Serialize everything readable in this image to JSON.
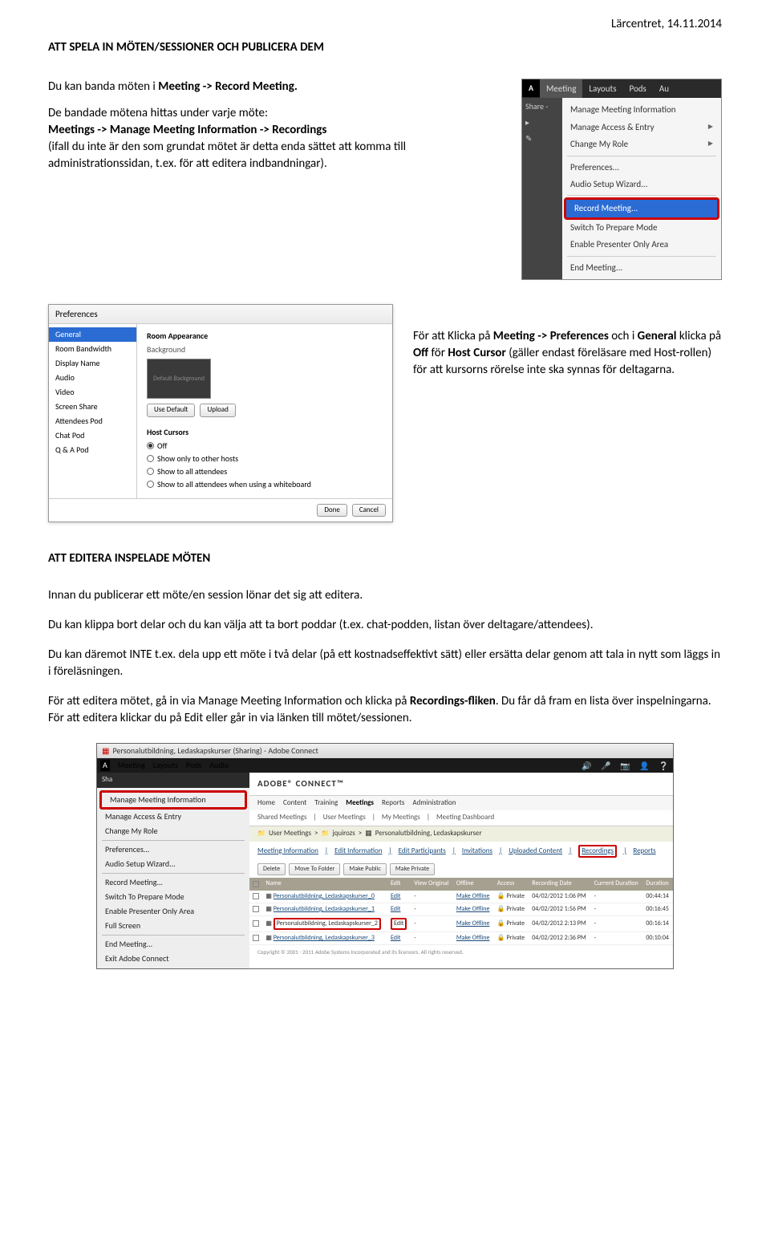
{
  "header_date": "Lärcentret, 14.11.2014",
  "doc_title": "ATT SPELA IN MÖTEN/SESSIONER OCH PUBLICERA DEM",
  "p1_a": "Du kan banda möten i ",
  "p1_b": "Meeting -> Record Meeting.",
  "p2_a": "De bandade mötena hittas under varje möte:",
  "p2_b": "Meetings -> Manage Meeting Information -> Recordings",
  "p2_c": "(ifall du inte är den som grundat mötet är detta enda sättet att komma till administrationssidan, t.ex. för att editera indbandningar).",
  "ss1": {
    "tabs": [
      "Meeting",
      "Layouts",
      "Pods",
      "Au"
    ],
    "share": "Share -",
    "items": [
      "Manage Meeting Information",
      "Manage Access & Entry",
      "Change My Role"
    ],
    "items2": [
      "Preferences...",
      "Audio Setup Wizard..."
    ],
    "record": "Record Meeting...",
    "items3": [
      "Switch To Prepare Mode",
      "Enable Presenter Only Area"
    ],
    "end": "End Meeting..."
  },
  "ss2": {
    "title": "Preferences",
    "side": [
      "General",
      "Room Bandwidth",
      "Display Name",
      "Audio",
      "Video",
      "Screen Share",
      "Attendees Pod",
      "Chat Pod",
      "Q & A Pod"
    ],
    "h1": "Room Appearance",
    "sub1": "Background",
    "thumb": "Default Background",
    "btn_use": "Use Default",
    "btn_up": "Upload",
    "h2": "Host Cursors",
    "r1": "Off",
    "r2": "Show only to other hosts",
    "r3": "Show to all attendees",
    "r4": "Show to all attendees when using a whiteboard",
    "done": "Done",
    "cancel": "Cancel"
  },
  "p3_a": "För att Klicka på ",
  "p3_b": "Meeting -> Preferences",
  "p3_c": " och i ",
  "p3_d": "General",
  "p3_e": " klicka på ",
  "p3_f": "Off",
  "p3_g": " för ",
  "p3_h": "Host Cursor",
  "p3_i": " (gäller endast föreläsare med Host-rollen) för att kursorns rörelse inte ska synnas för deltagarna.",
  "h2_editera": "ATT EDITERA INSPELADE MÖTEN",
  "p4": "Innan du publicerar ett möte/en session lönar det sig att editera.",
  "p5": "Du kan klippa bort delar och du kan välja att ta bort poddar (t.ex. chat-podden, listan över deltagare/attendees).",
  "p6": "Du kan däremot INTE t.ex. dela upp ett möte i två delar (på ett kostnadseffektivt sätt) eller ersätta delar genom att tala in nytt som läggs in i föreläsningen.",
  "p7_a": "För att editera mötet, gå in via Manage Meeting Information och klicka på ",
  "p7_b": "Recordings-fliken",
  "p7_c": ". Du får då fram en lista över inspelningarna. För att editera klickar du på Edit eller går in via länken till mötet/sessionen.",
  "ss3": {
    "titlebar": "Personalutbildning, Ledaskapskurser (Sharing) - Adobe Connect",
    "menubar": [
      "Meeting",
      "Layouts",
      "Pods",
      "Audio"
    ],
    "share": "Sha",
    "menu": {
      "mmi": "Manage Meeting Information",
      "items1": [
        "Manage Access & Entry",
        "Change My Role"
      ],
      "items2": [
        "Preferences...",
        "Audio Setup Wizard..."
      ],
      "items3": [
        "Record Meeting...",
        "Switch To Prepare Mode",
        "Enable Presenter Only Area",
        "Full Screen"
      ],
      "items4": [
        "End Meeting...",
        "Exit Adobe Connect"
      ]
    },
    "brand": "ADOBE® CONNECT™",
    "nav": [
      "Home",
      "Content",
      "Training",
      "Meetings",
      "Reports",
      "Administration"
    ],
    "nav2": [
      "Shared Meetings",
      "User Meetings",
      "My Meetings",
      "Meeting Dashboard"
    ],
    "crumb": [
      "User Meetings",
      "jquirozs",
      "Personalutbildning, Ledaskapskurser"
    ],
    "tabs": [
      "Meeting Information",
      "Edit Information",
      "Edit Participants",
      "Invitations",
      "Uploaded Content",
      "Recordings",
      "Reports"
    ],
    "btns": [
      "Delete",
      "Move To Folder",
      "Make Public",
      "Make Private"
    ],
    "th": [
      "",
      "Name",
      "Edit",
      "View Original",
      "Offline",
      "Access",
      "Recording Date",
      "Current Duration",
      "Duration"
    ],
    "rows": [
      {
        "name": "Personalutbildning, Ledaskapskurser_0",
        "edit": "Edit",
        "vo": "-",
        "off": "Make Offline",
        "acc": "Private",
        "date": "04/02/2012 1:06 PM",
        "cd": "-",
        "dur": "00:44:14"
      },
      {
        "name": "Personalutbildning, Ledaskapskurser_1",
        "edit": "Edit",
        "vo": "-",
        "off": "Make Offline",
        "acc": "Private",
        "date": "04/02/2012 1:56 PM",
        "cd": "-",
        "dur": "00:16:45"
      },
      {
        "name": "Personalutbildning, Ledaskapskurser_2",
        "edit": "Edit",
        "vo": "-",
        "off": "Make Offline",
        "acc": "Private",
        "date": "04/02/2012 2:13 PM",
        "cd": "-",
        "dur": "00:16:14"
      },
      {
        "name": "Personalutbildning, Ledaskapskurser_3",
        "edit": "Edit",
        "vo": "-",
        "off": "Make Offline",
        "acc": "Private",
        "date": "04/02/2012 2:36 PM",
        "cd": "-",
        "dur": "00:10:04"
      }
    ],
    "copyright": "Copyright © 2001 - 2011 Adobe Systems Incorporated and its licensors. All rights reserved."
  }
}
